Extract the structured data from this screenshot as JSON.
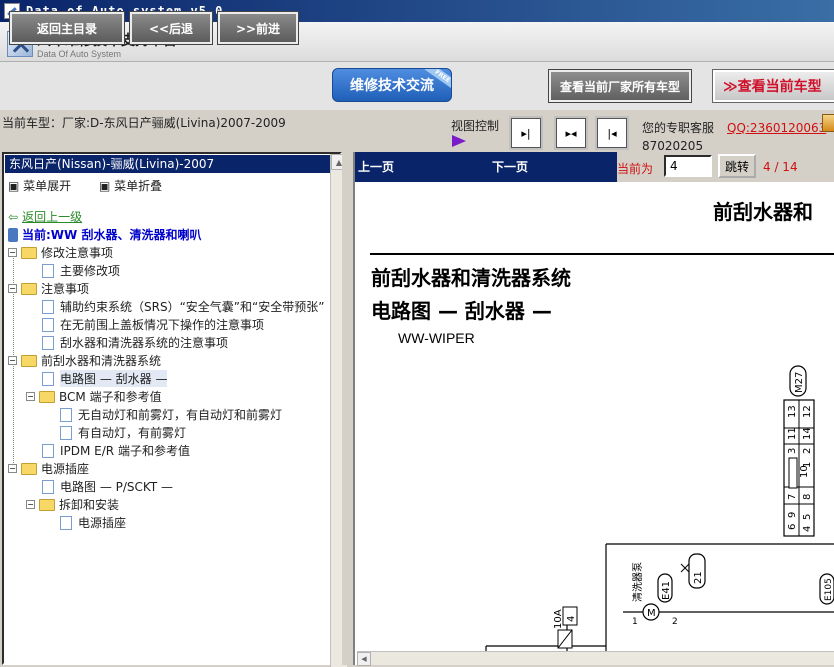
{
  "window": {
    "title": "Data of Auto system v5.0"
  },
  "brand": {
    "name": "汽车维修技术支持平台",
    "subtitle": "Data Of Auto System"
  },
  "toolbar": {
    "home": "返回主目录",
    "back": "<<后退",
    "forward": ">>前进",
    "exchange": "维修技术交流",
    "exchange_badge": "FREE",
    "all_models": "查看当前厂家所有车型",
    "current_model_btn": "≫查看当前车型"
  },
  "info": {
    "current_model": "当前车型：厂家:D-东风日产骊威(Livina)2007-2009",
    "view_control": "视图控制",
    "service_label": "您的专职客服",
    "service_qq": "QQ:2360120063",
    "service_id": "87020205"
  },
  "tree": {
    "header": "东风日产(Nissan)-骊威(Livina)-2007",
    "expand": "菜单展开",
    "collapse": "菜单折叠",
    "back_up": "返回上一级",
    "current": "当前:WW 刮水器、清洗器和喇叭",
    "nodes": [
      "修改注意事项",
      "主要修改项",
      "注意事项",
      "辅助约束系统（SRS）“安全气囊”和“安全带预张”",
      "在无前围上盖板情况下操作的注意事项",
      "刮水器和清洗器系统的注意事项",
      "前刮水器和清洗器系统",
      "电路图 — 刮水器 —",
      "BCM 端子和参考值",
      "无自动灯和前雾灯，有自动灯和前雾灯",
      "有自动灯，有前雾灯",
      "IPDM E/R 端子和参考值",
      "电源插座",
      "电路图 — P/SCKT —",
      "拆卸和安装",
      "电源插座"
    ]
  },
  "pager": {
    "prev": "上一页",
    "next": "下一页",
    "current_label": "当前为",
    "current_value": "4",
    "goto": "跳转",
    "count": "4 / 14"
  },
  "document": {
    "header_title": "前刮水器和",
    "title1": "前刮水器和清洗器系统",
    "title2": "电路图 — 刮水器 —",
    "code": "WW-WIPER",
    "labels": {
      "m27": "M27",
      "washer": "清洗器泵",
      "e41": "E41",
      "e105": "E105",
      "fuse10a": "10A",
      "fuse_4": "4",
      "fuse_6": "6",
      "pin_1": "1",
      "pin_2": "2",
      "pin_21": "21"
    },
    "connector_rows": [
      [
        "13",
        "12"
      ],
      [
        "11",
        "14"
      ],
      [
        "3",
        "2",
        "1"
      ],
      [
        "10"
      ],
      [
        "7",
        "8",
        "9"
      ],
      [
        "6",
        "5",
        "4"
      ]
    ]
  }
}
